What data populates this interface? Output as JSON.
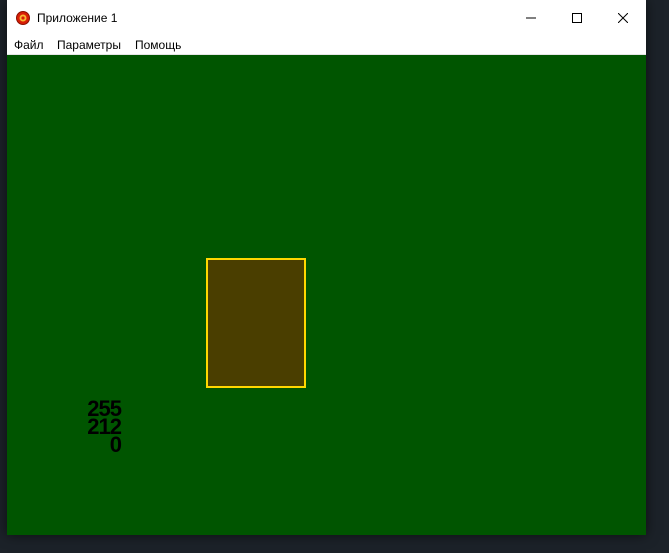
{
  "window": {
    "title": "Приложение 1",
    "controls": {
      "minimize": "minimize-icon",
      "maximize": "maximize-icon",
      "close": "close-icon"
    }
  },
  "menu": {
    "items": [
      "Файл",
      "Параметры",
      "Помощь"
    ]
  },
  "canvas": {
    "background_color": "#005500",
    "rectangle": {
      "fill_color": "#4a3e00",
      "border_color": "#ffd700"
    },
    "rgb_readout": {
      "r": "255",
      "g": "212",
      "b": "0"
    }
  },
  "colors": {
    "desktop": "#1c2229",
    "app_icon": "#d81e06"
  }
}
